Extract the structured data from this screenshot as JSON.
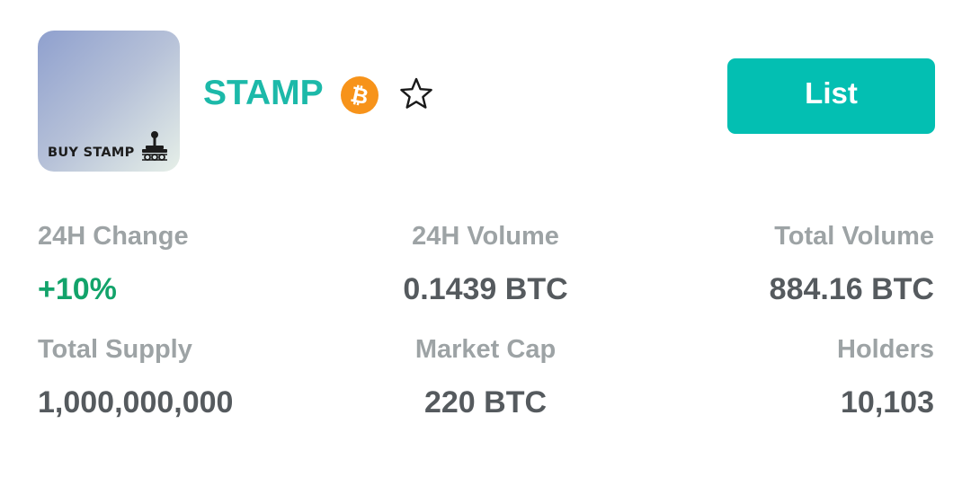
{
  "token": {
    "logo_text": "BUY STAMP",
    "name": "STAMP",
    "chain_icon": "bitcoin-icon",
    "favorite_icon": "star-outline-icon"
  },
  "actions": {
    "list_label": "List"
  },
  "colors": {
    "accent": "#1cb9a9",
    "button": "#03bfb2",
    "bitcoin": "#f7931a",
    "positive": "#12a36a",
    "label": "#9da3a5",
    "value": "#555a5e"
  },
  "stats": {
    "change_24h": {
      "label": "24H Change",
      "value": "+10%"
    },
    "volume_24h": {
      "label": "24H Volume",
      "value": "0.1439 BTC"
    },
    "total_volume": {
      "label": "Total Volume",
      "value": "884.16 BTC"
    },
    "total_supply": {
      "label": "Total Supply",
      "value": "1,000,000,000"
    },
    "market_cap": {
      "label": "Market Cap",
      "value": "220 BTC"
    },
    "holders": {
      "label": "Holders",
      "value": "10,103"
    }
  }
}
